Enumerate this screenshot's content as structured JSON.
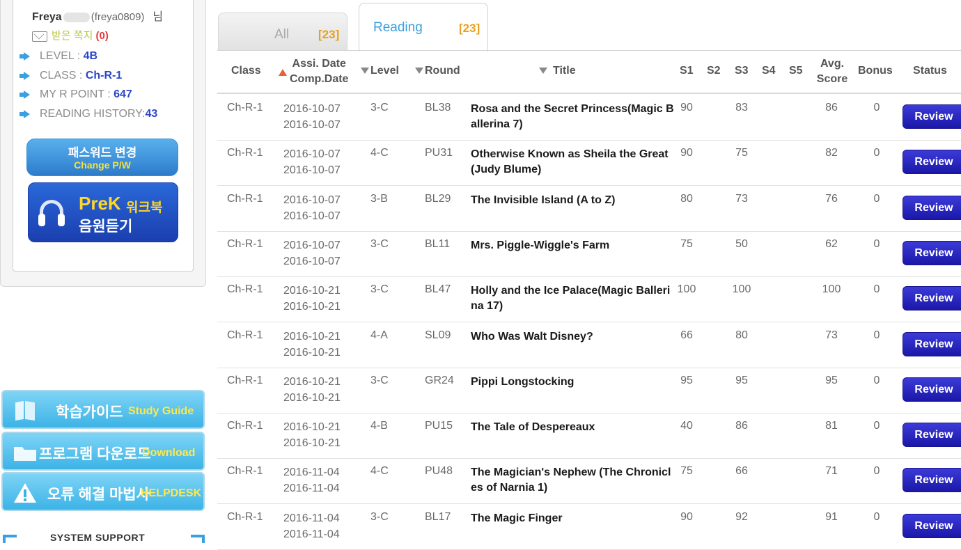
{
  "user": {
    "name": "Freya",
    "id": "(freya0809)",
    "suffix": "님",
    "messages_label": "받은 쪽지",
    "messages_count": "(0)"
  },
  "info": [
    {
      "label": "LEVEL :",
      "value": "4B"
    },
    {
      "label": "CLASS :",
      "value": "Ch-R-1"
    },
    {
      "label": "MY R POINT :",
      "value": "647"
    },
    {
      "label": "READING HISTORY:",
      "value": "43"
    }
  ],
  "buttons": {
    "password_ko": "패스워드 변경",
    "password_en": "Change P/W",
    "prek_1": "PreK",
    "prek_2": "워크북",
    "prek_3": "음원듣기",
    "study_ko": "학습가이드",
    "study_en": "Study Guide",
    "download_ko": "프로그램 다운로드",
    "download_en": "Download",
    "help_ko": "오류 해결 마법사",
    "help_en": "HELPDESK",
    "system_support": "SYSTEM SUPPORT"
  },
  "tabs": [
    {
      "label": "All",
      "count": "[23]"
    },
    {
      "label": "Reading",
      "count": "[23]"
    }
  ],
  "headers": {
    "class": "Class",
    "assi_date": "Assi. Date",
    "comp_date": "Comp.Date",
    "level": "Level",
    "round": "Round",
    "title": "Title",
    "s1": "S1",
    "s2": "S2",
    "s3": "S3",
    "s4": "S4",
    "s5": "S5",
    "avg_1": "Avg.",
    "avg_2": "Score",
    "bonus": "Bonus",
    "status": "Status"
  },
  "rows": [
    {
      "class": "Ch-R-1",
      "assi": "2016-10-07",
      "comp": "2016-10-07",
      "level": "3-C",
      "round": "BL38",
      "title": "Rosa and the Secret Princess(Magic Ballerina 7)",
      "s1": "90",
      "s2": "",
      "s3": "83",
      "s4": "",
      "s5": "",
      "avg": "86",
      "bonus": "0",
      "status": "Review"
    },
    {
      "class": "Ch-R-1",
      "assi": "2016-10-07",
      "comp": "2016-10-07",
      "level": "4-C",
      "round": "PU31",
      "title": "Otherwise Known as Sheila the Great (Judy Blume)",
      "s1": "90",
      "s2": "",
      "s3": "75",
      "s4": "",
      "s5": "",
      "avg": "82",
      "bonus": "0",
      "status": "Review"
    },
    {
      "class": "Ch-R-1",
      "assi": "2016-10-07",
      "comp": "2016-10-07",
      "level": "3-B",
      "round": "BL29",
      "title": "The Invisible Island (A to Z)",
      "s1": "80",
      "s2": "",
      "s3": "73",
      "s4": "",
      "s5": "",
      "avg": "76",
      "bonus": "0",
      "status": "Review"
    },
    {
      "class": "Ch-R-1",
      "assi": "2016-10-07",
      "comp": "2016-10-07",
      "level": "3-C",
      "round": "BL11",
      "title": "Mrs. Piggle-Wiggle's Farm",
      "s1": "75",
      "s2": "",
      "s3": "50",
      "s4": "",
      "s5": "",
      "avg": "62",
      "bonus": "0",
      "status": "Review"
    },
    {
      "class": "Ch-R-1",
      "assi": "2016-10-21",
      "comp": "2016-10-21",
      "level": "3-C",
      "round": "BL47",
      "title": "Holly and the Ice Palace(Magic Ballerina 17)",
      "s1": "100",
      "s2": "",
      "s3": "100",
      "s4": "",
      "s5": "",
      "avg": "100",
      "bonus": "0",
      "status": "Review"
    },
    {
      "class": "Ch-R-1",
      "assi": "2016-10-21",
      "comp": "2016-10-21",
      "level": "4-A",
      "round": "SL09",
      "title": "Who Was Walt Disney?",
      "s1": "66",
      "s2": "",
      "s3": "80",
      "s4": "",
      "s5": "",
      "avg": "73",
      "bonus": "0",
      "status": "Review"
    },
    {
      "class": "Ch-R-1",
      "assi": "2016-10-21",
      "comp": "2016-10-21",
      "level": "3-C",
      "round": "GR24",
      "title": "Pippi Longstocking",
      "s1": "95",
      "s2": "",
      "s3": "95",
      "s4": "",
      "s5": "",
      "avg": "95",
      "bonus": "0",
      "status": "Review"
    },
    {
      "class": "Ch-R-1",
      "assi": "2016-10-21",
      "comp": "2016-10-21",
      "level": "4-B",
      "round": "PU15",
      "title": "The Tale of Despereaux",
      "s1": "40",
      "s2": "",
      "s3": "86",
      "s4": "",
      "s5": "",
      "avg": "81",
      "bonus": "0",
      "status": "Review"
    },
    {
      "class": "Ch-R-1",
      "assi": "2016-11-04",
      "comp": "2016-11-04",
      "level": "4-C",
      "round": "PU48",
      "title": "The Magician's Nephew (The Chronicles of Narnia 1)",
      "s1": "75",
      "s2": "",
      "s3": "66",
      "s4": "",
      "s5": "",
      "avg": "71",
      "bonus": "0",
      "status": "Review"
    },
    {
      "class": "Ch-R-1",
      "assi": "2016-11-04",
      "comp": "2016-11-04",
      "level": "3-C",
      "round": "BL17",
      "title": "The Magic Finger",
      "s1": "90",
      "s2": "",
      "s3": "92",
      "s4": "",
      "s5": "",
      "avg": "91",
      "bonus": "0",
      "status": "Review"
    }
  ],
  "colors": {
    "accent_blue": "#3aa0dd",
    "count_orange": "#e8a020",
    "review_button": "#2a27c4",
    "info_value": "#2a46c8"
  }
}
